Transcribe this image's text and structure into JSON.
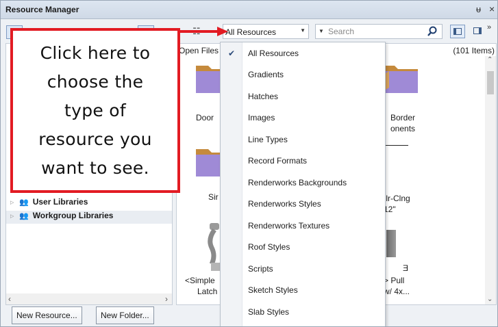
{
  "window": {
    "title": "Resource Manager",
    "pin_glyph": "ᵾ",
    "close_glyph": "×"
  },
  "toolbar": {
    "resource_type": "All Resources",
    "search_placeholder": "Search",
    "view_icon": "view-list-icon",
    "overflow_glyph": "»"
  },
  "libraries": {
    "items": [
      {
        "label": "User Libraries",
        "icon": "people-icon"
      },
      {
        "label": "Workgroup Libraries",
        "icon": "people-icon"
      }
    ]
  },
  "content": {
    "header_label": "Open Files",
    "items_count": "(101 Items)",
    "captions": {
      "door": "Door",
      "border_line1": "Border",
      "border_line2": "onents",
      "simple": "Sir",
      "flr_line1": "Flr-Clng",
      "flr_line2": "-12\"",
      "latch_line1": "<Simple",
      "latch_line2": "Latch",
      "pull_line0": "Ǝ",
      "pull_line1": "> Pull",
      "pull_line2": "w/ 4x..."
    }
  },
  "buttons": {
    "new_resource": "New Resource...",
    "new_folder": "New Folder..."
  },
  "dropdown": {
    "selected": "All Resources",
    "items": [
      "All Resources",
      "Gradients",
      "Hatches",
      "Images",
      "Line Types",
      "Record Formats",
      "Renderworks Backgrounds",
      "Renderworks Styles",
      "Renderworks Textures",
      "Roof Styles",
      "Scripts",
      "Sketch Styles",
      "Slab Styles"
    ]
  },
  "callout": {
    "lines": [
      "Click here to",
      "choose the",
      "type of",
      "resource you",
      "want to see."
    ],
    "color": "#e21b23"
  },
  "colors": {
    "accent": "#e21b23",
    "titlebar": "#cfd9e6",
    "selection_border": "#7f9bc3"
  }
}
